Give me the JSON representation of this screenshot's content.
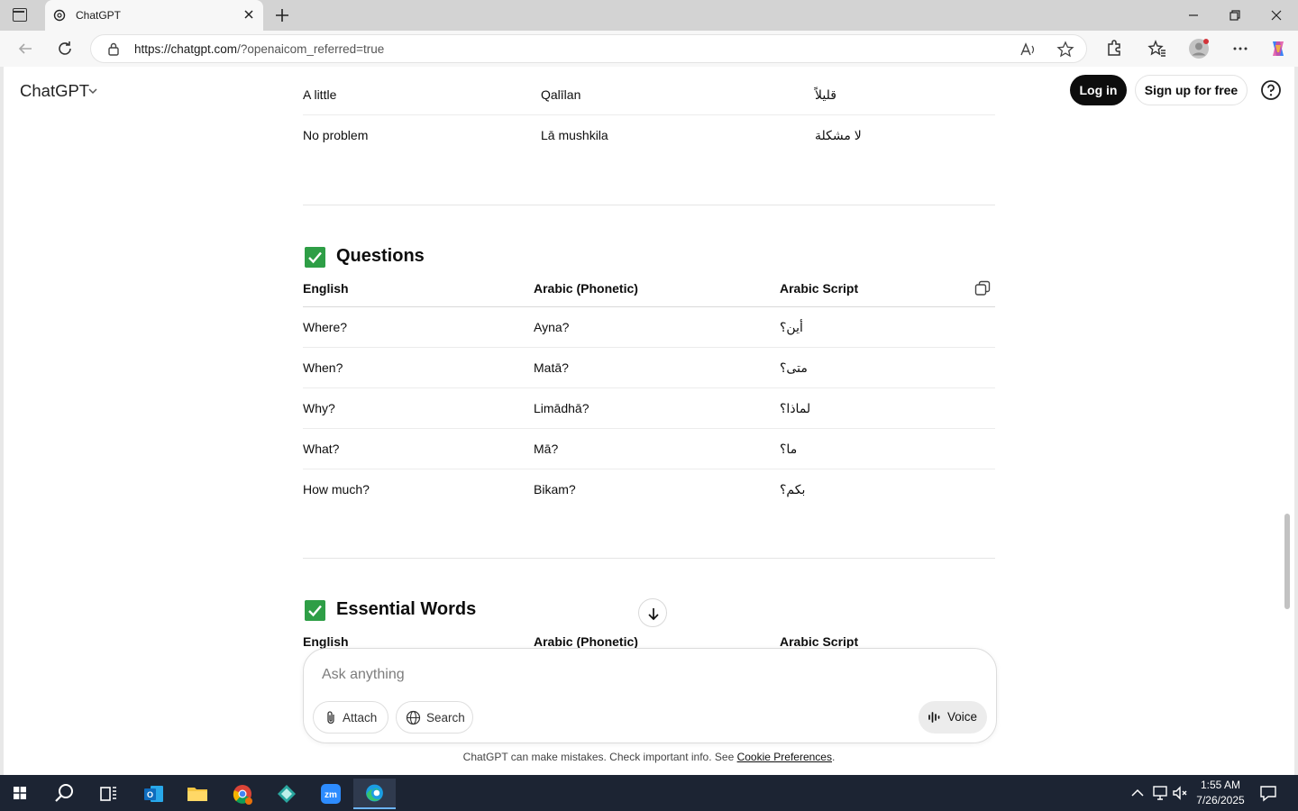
{
  "browser": {
    "tab_title": "ChatGPT",
    "url_domain": "https://chatgpt.com",
    "url_rest": "/?openaicom_referred=true"
  },
  "header": {
    "brand": "ChatGPT",
    "login_label": "Log in",
    "signup_label": "Sign up for free"
  },
  "top_rows": [
    {
      "english": "A little",
      "phonetic": "Qalīlan",
      "arabic": "قليلاً"
    },
    {
      "english": "No problem",
      "phonetic": "Lā mushkila",
      "arabic": "لا مشكلة"
    }
  ],
  "questions": {
    "title": "Questions",
    "headers": {
      "english": "English",
      "phonetic": "Arabic (Phonetic)",
      "arabic": "Arabic Script"
    },
    "rows": [
      {
        "english": "Where?",
        "phonetic": "Ayna?",
        "arabic": "أين؟"
      },
      {
        "english": "When?",
        "phonetic": "Matā?",
        "arabic": "متى؟"
      },
      {
        "english": "Why?",
        "phonetic": "Limādhā?",
        "arabic": "لماذا؟"
      },
      {
        "english": "What?",
        "phonetic": "Mā?",
        "arabic": "ما؟"
      },
      {
        "english": "How much?",
        "phonetic": "Bikam?",
        "arabic": "بكم؟"
      }
    ]
  },
  "essential_words": {
    "title": "Essential Words",
    "headers": {
      "english": "English",
      "phonetic": "Arabic (Phonetic)",
      "arabic": "Arabic Script"
    }
  },
  "composer": {
    "placeholder": "Ask anything",
    "attach_label": "Attach",
    "search_label": "Search",
    "voice_label": "Voice"
  },
  "footer": {
    "note": "ChatGPT can make mistakes. Check important info. See",
    "link": "Cookie Preferences",
    "trail": "."
  },
  "taskbar": {
    "time": "1:55 AM",
    "date": "7/26/2025"
  },
  "colors": {
    "check_green": "#2e9e46",
    "login_bg": "#0d0d0d",
    "taskbar_bg": "#1c2433"
  }
}
